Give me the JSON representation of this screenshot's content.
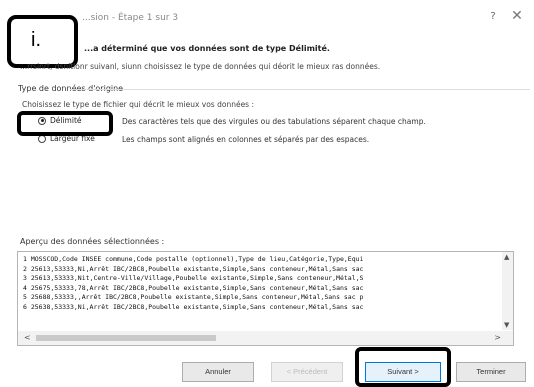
{
  "window": {
    "title": "...sion - Étape 1 sur 3",
    "help_glyph": "?",
    "close_glyph": "✕"
  },
  "callouts": {
    "i_label": "i."
  },
  "heading": "...a déterminé que vos données sont de type Délimité.",
  "instruction": "...rrsinrt, dsnitlonr suivanl, siunn choisissez le type de données qui déorit le mieux ras données.",
  "source_type": {
    "section_label": "Type de données d'origine",
    "choose_label": "Choisissez le type de fichier qui décrit le mieux vos données :",
    "options": [
      {
        "label": "Délimité",
        "description": "Des caractères tels que des virgules ou des tabulations séparent chaque champ.",
        "checked": true
      },
      {
        "label": "Largeur fixe",
        "description": "Les champs sont alignés en colonnes et séparés par des espaces.",
        "checked": false
      }
    ]
  },
  "preview": {
    "label": "Aperçu des données sélectionnées :",
    "lines": [
      "1 MOSSCOD,Code INSEE commune,Code postalle (optionnel),Type de lieu,Catégorie,Type,Equi",
      "2 25613,53333,Ni,Arrêt IBC/2BC8,Poubelle existante,Simple,Sans conteneur,Métal,Sans sac",
      "3 25613,53333,Nit,Centre-Ville/Village,Poubelle existante,Simple,Sans conteneur,Métal,S",
      "4 25675,53333,78,Arrêt IBC/2BC8,Poubelle existante,Simple,Sans conteneur,Métal,Sans sac",
      "5 25688,53333,,Arrêt IBC/2BC8,Poubelle existante,Simple,Sans conteneur,Métal,Sans sac p",
      "6 25638,53333,Ni,Arrêt IBC/2BC8,Poubelle existante,Simple,Sans conteneur,Métal,Sans sac"
    ]
  },
  "buttons": {
    "cancel": "Annuler",
    "previous": "< Précédent",
    "next": "Suivant >",
    "finish": "Terminer"
  },
  "colors": {
    "accent_border": "#0078d7",
    "callout": "#000000"
  },
  "icons": [
    "help-icon",
    "close-icon",
    "scroll-up-icon",
    "scroll-down-icon",
    "scroll-left-icon",
    "scroll-right-icon"
  ]
}
